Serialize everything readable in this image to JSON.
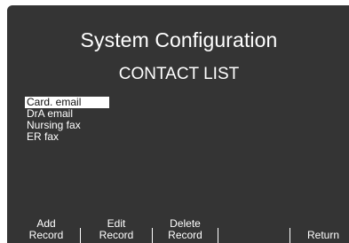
{
  "screen": {
    "title": "System Configuration",
    "subtitle": "CONTACT LIST"
  },
  "contacts": [
    {
      "label": "Card. email",
      "selected": true
    },
    {
      "label": "DrA email",
      "selected": false
    },
    {
      "label": "Nursing fax",
      "selected": false
    },
    {
      "label": "ER fax",
      "selected": false
    }
  ],
  "softkeys": {
    "add": {
      "line1": "Add",
      "line2": "Record"
    },
    "edit": {
      "line1": "Edit",
      "line2": "Record"
    },
    "delete": {
      "line1": "Delete",
      "line2": "Record"
    },
    "blank": {
      "line1": "",
      "line2": ""
    },
    "return": {
      "line1": "",
      "line2": "Return"
    }
  },
  "colors": {
    "background": "#343434",
    "text": "#ffffff",
    "selection": "#ffffff"
  }
}
